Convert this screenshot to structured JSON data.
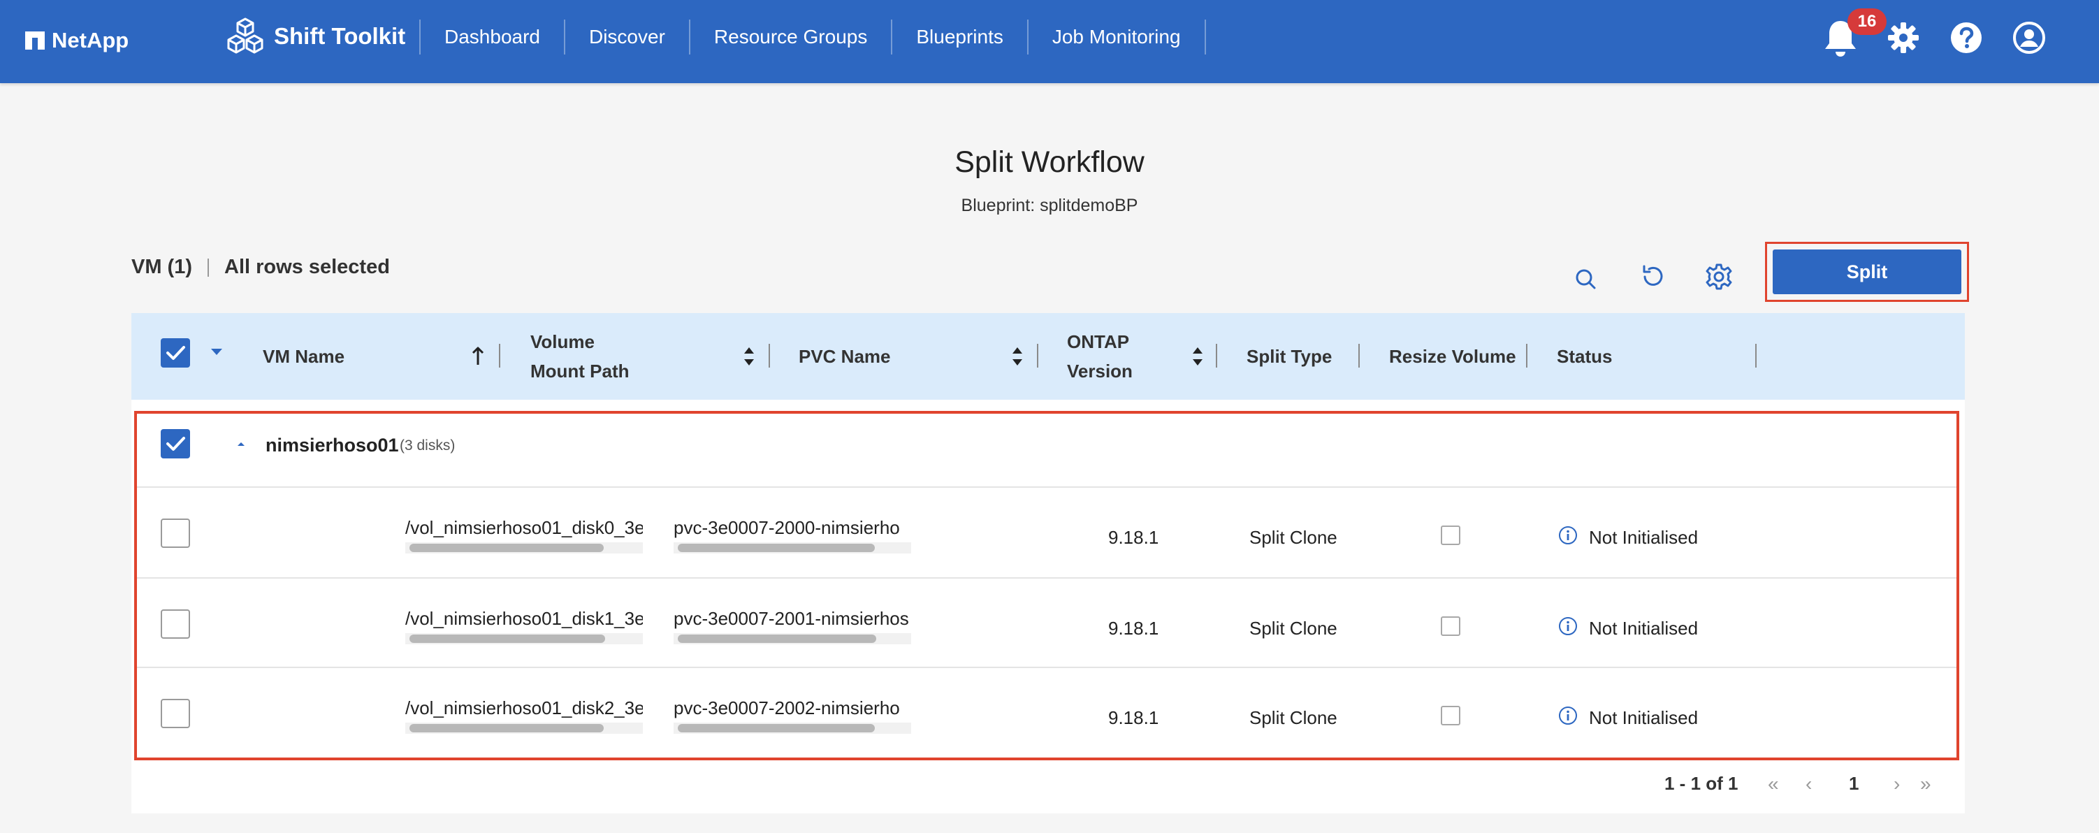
{
  "topbar": {
    "brand": "NetApp",
    "app_name": "Shift Toolkit",
    "nav": [
      "Dashboard",
      "Discover",
      "Resource Groups",
      "Blueprints",
      "Job Monitoring"
    ],
    "notification_count": "16",
    "icons": [
      "bell-icon",
      "gear-icon",
      "help-icon",
      "user-icon"
    ]
  },
  "page": {
    "title": "Split Workflow",
    "subtitle": "Blueprint: splitdemoBP"
  },
  "toolbar": {
    "vm_count": "VM (1)",
    "selection": "All rows selected",
    "split_label": "Split",
    "icons": [
      "search-icon",
      "refresh-icon",
      "settings-icon"
    ]
  },
  "table": {
    "columns": {
      "vm_name": "VM Name",
      "volume_line1": "Volume",
      "volume_line2": "Mount Path",
      "pvc_name": "PVC Name",
      "ontap_line1": "ONTAP",
      "ontap_line2": "Version",
      "split_type": "Split Type",
      "resize_volume": "Resize Volume",
      "status": "Status"
    },
    "group": {
      "vm_name": "nimsierhoso01",
      "disk_count": "(3 disks)"
    },
    "rows": [
      {
        "volume": "/vol_nimsierhoso01_disk0_3e",
        "pvc": "pvc-3e0007-2000-nimsierho",
        "ontap": "9.18.1",
        "split_type": "Split Clone",
        "status": "Not Initialised"
      },
      {
        "volume": "/vol_nimsierhoso01_disk1_3e",
        "pvc": "pvc-3e0007-2001-nimsierhos",
        "ontap": "9.18.1",
        "split_type": "Split Clone",
        "status": "Not Initialised"
      },
      {
        "volume": "/vol_nimsierhoso01_disk2_3e",
        "pvc": "pvc-3e0007-2002-nimsierho",
        "ontap": "9.18.1",
        "split_type": "Split Clone",
        "status": "Not Initialised"
      }
    ]
  },
  "pagination": {
    "range": "1 - 1 of 1",
    "page": "1"
  },
  "colors": {
    "brand_blue": "#2d67c1",
    "header_row": "#daebfb",
    "highlight_red": "#e0442e",
    "badge_red": "#d63a3a"
  }
}
